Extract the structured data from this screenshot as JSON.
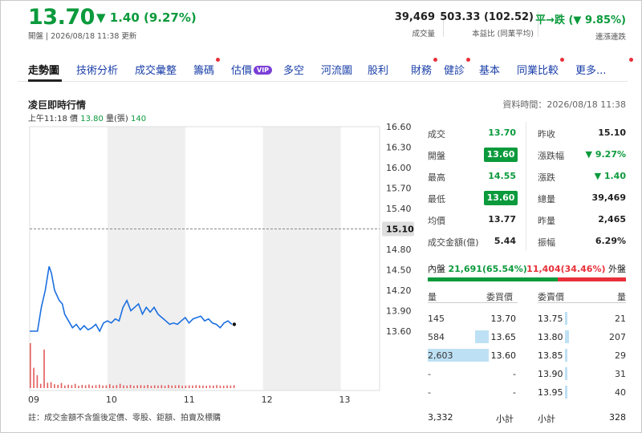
{
  "header": {
    "price": "13.70",
    "change": "▼ 1.40 (9.27%)",
    "updated": "開盤 | 2026/08/18 11:38 更新",
    "stats": [
      {
        "value": "39,469",
        "label": "成交量"
      },
      {
        "value": "503.33 (102.52)",
        "label": "本益比 (同業平均)"
      },
      {
        "value": "平→跌 (▼ 9.85%)",
        "label": "連漲連跌"
      }
    ]
  },
  "tabs": [
    {
      "label": "走勢圖",
      "active": true
    },
    {
      "label": "技術分析"
    },
    {
      "label": "成交彙整"
    },
    {
      "label": "籌碼",
      "dot": true
    },
    {
      "label": "估價",
      "badge": "VIP"
    },
    {
      "label": "多空"
    },
    {
      "label": "河流圖"
    },
    {
      "label": "股利"
    },
    {
      "label": "財務",
      "dot": true
    },
    {
      "label": "健診",
      "dot": true
    },
    {
      "label": "基本"
    },
    {
      "label": "同業比較",
      "dot": true
    },
    {
      "label": "更多...",
      "dot": true
    }
  ],
  "chart": {
    "title": "凌巨即時行情",
    "data_time": "資料時間：2026/08/18 11:38",
    "legend_time": "上午11:18",
    "legend_price_label": "價",
    "legend_price": "13.80",
    "legend_vol_label": "量(張)",
    "legend_vol": "140",
    "note": "註：成交金額不含盤後定價、零股、鉅額、拍賣及標購"
  },
  "chart_data": {
    "type": "line",
    "ylim": [
      13.6,
      16.6
    ],
    "y_ticks": [
      "16.60",
      "16.30",
      "16.00",
      "15.70",
      "15.40",
      "15.10",
      "14.80",
      "14.50",
      "14.20",
      "13.90",
      "13.60"
    ],
    "reference_price": "15.10",
    "x_ticks": [
      "09",
      "10",
      "11",
      "12",
      "13"
    ],
    "x_range_hours": [
      9,
      13.5
    ],
    "series": [
      {
        "values": [
          [
            9.0,
            13.6
          ],
          [
            9.05,
            13.6
          ],
          [
            9.1,
            13.6
          ],
          [
            9.15,
            13.95
          ],
          [
            9.2,
            14.2
          ],
          [
            9.25,
            14.55
          ],
          [
            9.28,
            14.45
          ],
          [
            9.32,
            14.2
          ],
          [
            9.38,
            14.05
          ],
          [
            9.42,
            14.0
          ],
          [
            9.45,
            13.85
          ],
          [
            9.5,
            13.75
          ],
          [
            9.55,
            13.65
          ],
          [
            9.6,
            13.7
          ],
          [
            9.65,
            13.62
          ],
          [
            9.7,
            13.68
          ],
          [
            9.75,
            13.62
          ],
          [
            9.8,
            13.65
          ],
          [
            9.85,
            13.7
          ],
          [
            9.9,
            13.6
          ],
          [
            9.95,
            13.72
          ],
          [
            10.0,
            13.75
          ],
          [
            10.05,
            13.72
          ],
          [
            10.1,
            13.78
          ],
          [
            10.15,
            13.75
          ],
          [
            10.2,
            13.95
          ],
          [
            10.25,
            14.05
          ],
          [
            10.3,
            13.9
          ],
          [
            10.35,
            13.95
          ],
          [
            10.4,
            14.0
          ],
          [
            10.45,
            13.85
          ],
          [
            10.5,
            13.95
          ],
          [
            10.55,
            13.88
          ],
          [
            10.6,
            13.95
          ],
          [
            10.65,
            13.85
          ],
          [
            10.7,
            13.8
          ],
          [
            10.75,
            13.75
          ],
          [
            10.8,
            13.7
          ],
          [
            10.85,
            13.72
          ],
          [
            10.9,
            13.7
          ],
          [
            10.95,
            13.75
          ],
          [
            11.0,
            13.8
          ],
          [
            11.05,
            13.72
          ],
          [
            11.1,
            13.78
          ],
          [
            11.15,
            13.8
          ],
          [
            11.2,
            13.82
          ],
          [
            11.25,
            13.75
          ],
          [
            11.3,
            13.78
          ],
          [
            11.35,
            13.72
          ],
          [
            11.4,
            13.7
          ],
          [
            11.45,
            13.65
          ],
          [
            11.5,
            13.72
          ],
          [
            11.55,
            13.75
          ],
          [
            11.6,
            13.7
          ]
        ]
      }
    ],
    "volume": [
      210,
      95,
      60,
      20,
      180,
      25,
      28,
      18,
      15,
      24,
      12,
      16,
      14,
      20,
      11,
      15,
      13,
      17,
      12,
      14,
      16,
      12,
      13,
      18,
      12,
      14,
      20,
      13,
      12,
      15,
      11,
      13,
      14,
      12,
      15,
      11,
      13,
      12,
      14,
      11,
      15,
      12,
      13,
      14,
      11,
      12,
      13,
      12,
      14,
      13,
      12,
      11,
      13,
      12,
      14,
      12,
      11,
      13,
      12,
      14
    ]
  },
  "quote": {
    "left": [
      {
        "label": "成交",
        "value": "13.70",
        "style": "green"
      },
      {
        "label": "開盤",
        "value": "13.60",
        "style": "box"
      },
      {
        "label": "最高",
        "value": "14.55",
        "style": "green"
      },
      {
        "label": "最低",
        "value": "13.60",
        "style": "box"
      },
      {
        "label": "均價",
        "value": "13.77",
        "style": "plain"
      },
      {
        "label": "成交金額(億)",
        "value": "5.44",
        "style": "plain"
      }
    ],
    "right": [
      {
        "label": "昨收",
        "value": "15.10",
        "style": "plain"
      },
      {
        "label": "漲跌幅",
        "value": "▼ 9.27%",
        "style": "green"
      },
      {
        "label": "漲跌",
        "value": "▼ 1.40",
        "style": "green"
      },
      {
        "label": "總量",
        "value": "39,469",
        "style": "plain"
      },
      {
        "label": "昨量",
        "value": "2,465",
        "style": "plain"
      },
      {
        "label": "振幅",
        "value": "6.29%",
        "style": "plain"
      }
    ]
  },
  "inout": {
    "in_label": "內盤",
    "in_value": "21,691(65.54%)",
    "in_pct": 65.54,
    "out_value": "11,404(34.46%)",
    "out_label": "外盤"
  },
  "orderbook": {
    "headers": {
      "bid_qty": "量",
      "bid_price": "委買價",
      "ask_price": "委賣價",
      "ask_qty": "量"
    },
    "bids": [
      {
        "qty": "145",
        "price": "13.70",
        "frac": 0.0
      },
      {
        "qty": "584",
        "price": "13.65",
        "frac": 0.22
      },
      {
        "qty": "2,603",
        "price": "13.60",
        "frac": 1.0
      },
      {
        "qty": "-",
        "price": "-",
        "frac": 0.0
      },
      {
        "qty": "-",
        "price": "-",
        "frac": 0.0
      }
    ],
    "asks": [
      {
        "price": "13.75",
        "qty": "21",
        "frac": 0.02
      },
      {
        "price": "13.80",
        "qty": "207",
        "frac": 0.06
      },
      {
        "price": "13.85",
        "qty": "29",
        "frac": 0.02
      },
      {
        "price": "13.90",
        "qty": "31",
        "frac": 0.02
      },
      {
        "price": "13.95",
        "qty": "40",
        "frac": 0.02
      }
    ],
    "bid_total": "3,332",
    "bid_total_label": "小計",
    "ask_total_label": "小計",
    "ask_total": "328"
  }
}
